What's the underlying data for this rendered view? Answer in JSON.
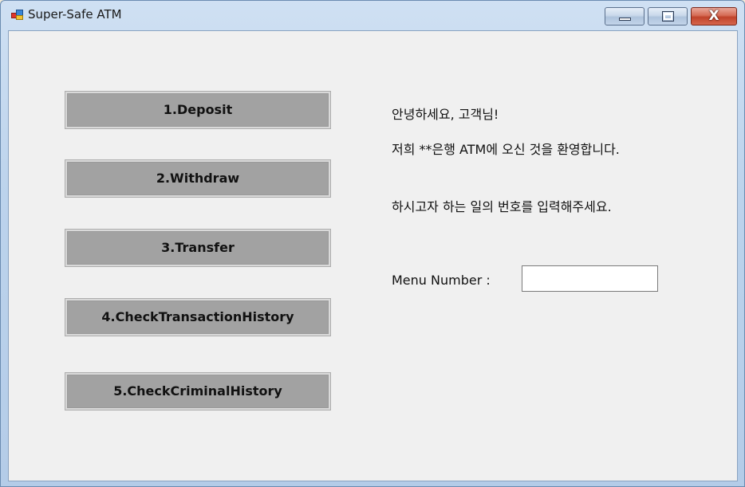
{
  "window": {
    "title": "Super-Safe ATM",
    "app_icon": "windows-form-icon",
    "controls": {
      "minimize_icon": "minimize-icon",
      "maximize_icon": "maximize-icon",
      "close_icon": "close-icon",
      "close_glyph": "X"
    }
  },
  "menu": {
    "buttons": [
      {
        "label": "1.Deposit"
      },
      {
        "label": "2.Withdraw"
      },
      {
        "label": "3.Transfer"
      },
      {
        "label": "4.CheckTransactionHistory"
      },
      {
        "label": "5.CheckCriminalHistory"
      }
    ]
  },
  "greeting": {
    "line1": "안녕하세요, 고객님!",
    "line2": "저희 **은행 ATM에 오신 것을 환영합니다.",
    "prompt": "하시고자 하는 일의 번호를 입력해주세요."
  },
  "menu_number": {
    "label": "Menu Number :",
    "value": ""
  },
  "colors": {
    "button_face": "#a2a2a2",
    "client_background": "#f0f0f0",
    "close_button": "#c0432b"
  }
}
